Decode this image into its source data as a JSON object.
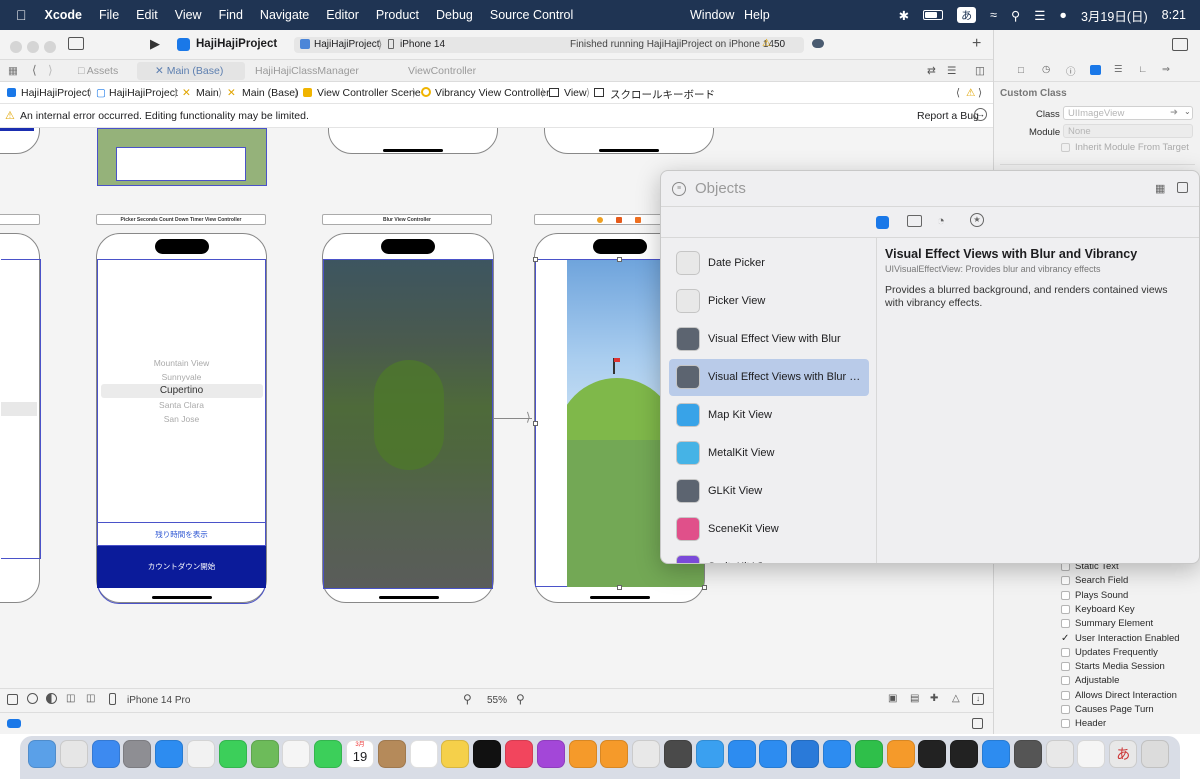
{
  "menubar": {
    "app_name": "Xcode",
    "items": [
      "File",
      "Edit",
      "View",
      "Find",
      "Navigate",
      "Editor",
      "Product",
      "Debug",
      "Source Control",
      "Window",
      "Help"
    ],
    "ime": "あ",
    "date": "3月19日(日)",
    "time": "8:21",
    "battery_icon": "battery-icon"
  },
  "toolbar": {
    "project_name": "HajiHajiProject",
    "scheme": "HajiHajiProject",
    "device": "iPhone 14",
    "status": "Finished running HajiHajiProject on iPhone 14",
    "warning_count": "50"
  },
  "tabs": [
    "Assets",
    "Main (Base)",
    "HajiHajiClassManager",
    "ViewController"
  ],
  "breadcrumbs": [
    "HajiHajiProject",
    "HajiHajiProject",
    "Main",
    "Main (Base)",
    "View Controller Scene",
    "Vibrancy View Controller",
    "View",
    "スクロールキーボード"
  ],
  "error_bar": {
    "message": "An internal error occurred. Editing functionality may be limited.",
    "report": "Report a Bug"
  },
  "canvas": {
    "picker_vc_title": "Picker Seconds Count Down Timer View Controller",
    "blur_vc_title": "Blur View Controller",
    "picker_rows": [
      "Mountain View",
      "Sunnyvale",
      "Cupertino",
      "Santa Clara",
      "San Jose"
    ],
    "show_time_button": "残り時間を表示",
    "start_countdown_button": "カウントダウン開始"
  },
  "bottom_bar": {
    "device": "iPhone 14 Pro",
    "zoom": "55%"
  },
  "inspector": {
    "section_title": "Custom Class",
    "class_label": "Class",
    "class_placeholder": "UIImageView",
    "module_label": "Module",
    "module_placeholder": "None",
    "inherit_label": "Inherit Module From Target",
    "traits": [
      {
        "label": "Static Text",
        "checked": false
      },
      {
        "label": "Search Field",
        "checked": false
      },
      {
        "label": "Plays Sound",
        "checked": false
      },
      {
        "label": "Keyboard Key",
        "checked": false
      },
      {
        "label": "Summary Element",
        "checked": false
      },
      {
        "label": "User Interaction Enabled",
        "checked": true
      },
      {
        "label": "Updates Frequently",
        "checked": false
      },
      {
        "label": "Starts Media Session",
        "checked": false
      },
      {
        "label": "Adjustable",
        "checked": false
      },
      {
        "label": "Allows Direct Interaction",
        "checked": false
      },
      {
        "label": "Causes Page Turn",
        "checked": false
      },
      {
        "label": "Header",
        "checked": false
      }
    ]
  },
  "objects_panel": {
    "search_placeholder": "Objects",
    "items": [
      {
        "label": "Date Picker",
        "icon": "date-picker-icon",
        "color": "#e8e8e8"
      },
      {
        "label": "Picker View",
        "icon": "picker-view-icon",
        "color": "#e8e8e8"
      },
      {
        "label": "Visual Effect View with Blur",
        "icon": "blur-view-icon",
        "color": "#5c6470"
      },
      {
        "label": "Visual Effect Views with Blur and Vibrancy",
        "icon": "vibrancy-view-icon",
        "color": "#5c6470",
        "selected": true
      },
      {
        "label": "Map Kit View",
        "icon": "map-icon",
        "color": "#38a3e8"
      },
      {
        "label": "MetalKit View",
        "icon": "metal-icon",
        "color": "#45b3e6"
      },
      {
        "label": "GLKit View",
        "icon": "glkit-icon",
        "color": "#5c6470"
      },
      {
        "label": "SceneKit View",
        "icon": "scenekit-icon",
        "color": "#e0508a"
      },
      {
        "label": "SpriteKit View",
        "icon": "spritekit-icon",
        "color": "#7b4ad9"
      }
    ],
    "detail_title": "Visual Effect Views with Blur and Vibrancy",
    "detail_subtitle": "UIVisualEffectView: Provides blur and vibrancy effects",
    "detail_body": "Provides a blurred background, and renders contained views with vibrancy effects."
  },
  "dock": {
    "calendar_month": "3月",
    "calendar_day": "19",
    "ime_label": "あ",
    "icons": [
      "finder",
      "launchpad",
      "mail",
      "system-settings",
      "safari",
      "chrome",
      "messages",
      "maps",
      "photos",
      "facetime",
      "calendar",
      "notes-app",
      "reminders",
      "notes",
      "tv",
      "music",
      "podcasts",
      "books",
      "pages",
      "preview-alt",
      "instruments",
      "testflight",
      "app-store",
      "xcode",
      "vscode",
      "keynote",
      "numbers",
      "pages-alt",
      "github",
      "terminal",
      "zoom",
      "calculator",
      "preview",
      "textedit",
      "kotoeri",
      "trash"
    ]
  },
  "colors": {
    "menubar": "#1f3453",
    "selection": "#b9cbe9",
    "accent": "#0a64d9",
    "countdown_button": "#0b1b9a"
  }
}
